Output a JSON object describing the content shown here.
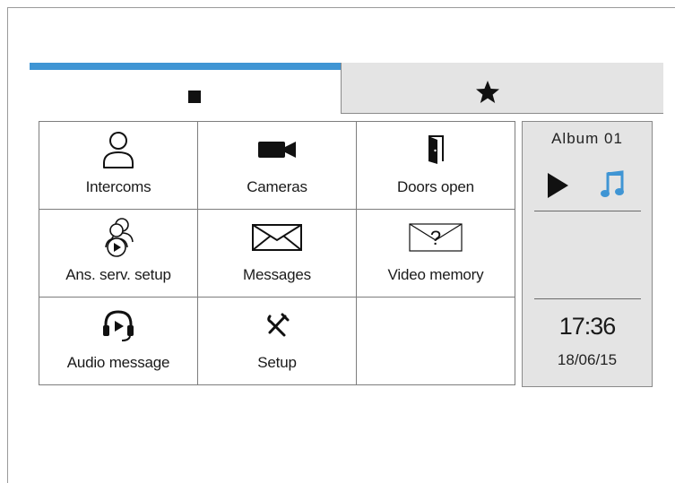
{
  "tabs": [
    {
      "id": "home",
      "icon": "home-square-icon",
      "active": true
    },
    {
      "id": "favorites",
      "icon": "star-icon",
      "active": false
    }
  ],
  "colors": {
    "accent": "#3f95d4",
    "panel": "#e4e4e4",
    "note": "#3f95d4"
  },
  "grid": {
    "items": [
      {
        "label": "Intercoms",
        "icon": "user-icon"
      },
      {
        "label": "Cameras",
        "icon": "video-camera-icon"
      },
      {
        "label": "Doors open",
        "icon": "door-icon"
      },
      {
        "label": "Ans. serv. setup",
        "icon": "answering-service-icon"
      },
      {
        "label": "Messages",
        "icon": "envelope-icon"
      },
      {
        "label": "Video memory",
        "icon": "video-memory-envelope-icon"
      },
      {
        "label": "Audio message",
        "icon": "headset-play-icon"
      },
      {
        "label": "Setup",
        "icon": "tools-icon"
      }
    ]
  },
  "media": {
    "album": "Album 01",
    "play_icon": "play-icon",
    "note_icon": "music-note-icon"
  },
  "clock": {
    "time": "17:36",
    "date": "18/06/15"
  }
}
